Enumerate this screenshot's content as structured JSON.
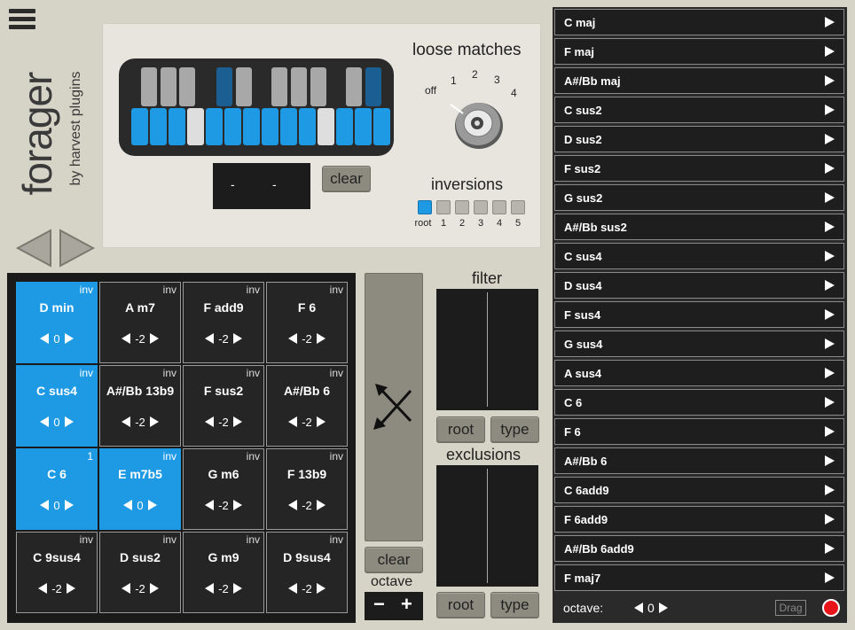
{
  "brand": {
    "title": "forager",
    "subtitle": "by harvest plugins"
  },
  "top": {
    "display_left": "-",
    "display_right": "-",
    "clear_label": "clear",
    "loose_label": "loose matches",
    "loose_options": [
      "off",
      "1",
      "2",
      "3",
      "4"
    ],
    "loose_selected": "off",
    "inversions_label": "inversions",
    "inversion_options": [
      "root",
      "1",
      "2",
      "3",
      "4",
      "5"
    ],
    "inversion_selected": "root",
    "active_black_keys": [
      3,
      9
    ],
    "inactive_white_keys": [
      3,
      10
    ]
  },
  "grid": {
    "cells": [
      {
        "name": "D min",
        "value": "0",
        "tag": "inv",
        "active": true
      },
      {
        "name": "A m7",
        "value": "-2",
        "tag": "inv",
        "active": false
      },
      {
        "name": "F add9",
        "value": "-2",
        "tag": "inv",
        "active": false
      },
      {
        "name": "F 6",
        "value": "-2",
        "tag": "inv",
        "active": false
      },
      {
        "name": "C sus4",
        "value": "0",
        "tag": "inv",
        "active": true
      },
      {
        "name": "A#/Bb 13b9",
        "value": "-2",
        "tag": "inv",
        "active": false
      },
      {
        "name": "F sus2",
        "value": "-2",
        "tag": "inv",
        "active": false
      },
      {
        "name": "A#/Bb 6",
        "value": "-2",
        "tag": "inv",
        "active": false
      },
      {
        "name": "C 6",
        "value": "0",
        "tag": "1",
        "active": true
      },
      {
        "name": "E m7b5",
        "value": "0",
        "tag": "inv",
        "active": true
      },
      {
        "name": "G m6",
        "value": "-2",
        "tag": "inv",
        "active": false
      },
      {
        "name": "F 13b9",
        "value": "-2",
        "tag": "inv",
        "active": false
      },
      {
        "name": "C 9sus4",
        "value": "-2",
        "tag": "inv",
        "active": false
      },
      {
        "name": "D sus2",
        "value": "-2",
        "tag": "inv",
        "active": false
      },
      {
        "name": "G m9",
        "value": "-2",
        "tag": "inv",
        "active": false
      },
      {
        "name": "D 9sus4",
        "value": "-2",
        "tag": "inv",
        "active": false
      }
    ]
  },
  "pad": {
    "clear_label": "clear",
    "octave_label": "octave",
    "minus": "−",
    "plus": "+"
  },
  "filter": {
    "label": "filter",
    "root_label": "root",
    "type_label": "type"
  },
  "exclusions": {
    "label": "exclusions",
    "root_label": "root",
    "type_label": "type"
  },
  "list": {
    "items": [
      "C maj",
      "F maj",
      "A#/Bb maj",
      "C sus2",
      "D sus2",
      "F sus2",
      "G sus2",
      "A#/Bb sus2",
      "C sus4",
      "D sus4",
      "F sus4",
      "G sus4",
      "A sus4",
      "C 6",
      "F 6",
      "A#/Bb 6",
      "C 6add9",
      "F 6add9",
      "A#/Bb 6add9",
      "F maj7"
    ],
    "octave_label": "octave:",
    "octave_value": "0",
    "drag_label": "Drag"
  }
}
